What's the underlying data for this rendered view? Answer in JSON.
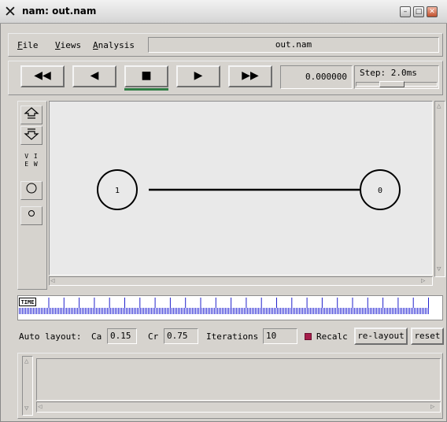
{
  "window": {
    "title": "nam: out.nam",
    "app_icon": "x-logo-icon",
    "controls": [
      "minimize-icon",
      "maximize-icon",
      "close-icon"
    ]
  },
  "menubar": {
    "file_accel": "F",
    "file_rest": "ile",
    "views_accel": "V",
    "views_rest": "iews",
    "analysis_accel": "A",
    "analysis_rest": "nalysis",
    "filename": "out.nam"
  },
  "controls": {
    "rewind": "◀◀",
    "back": "◀",
    "stop": "■",
    "play": "▶",
    "fast_forward": "▶▶",
    "time": "0.000000",
    "step_label": "Step: 2.0ms",
    "active_color": "#2f7d44"
  },
  "toolbar": {
    "view_label_line1": "V I",
    "view_label_line2": "E W",
    "zoom_in_icon": "zoom-in-arrow-icon",
    "zoom_out_icon": "zoom-out-arrow-icon",
    "large_circle_icon": "large-node-icon",
    "small_circle_icon": "small-node-icon"
  },
  "network": {
    "nodes": [
      {
        "id": "1",
        "label": "1"
      },
      {
        "id": "0",
        "label": "0"
      }
    ],
    "links": [
      {
        "from": "1",
        "to": "0"
      }
    ]
  },
  "timeline": {
    "label": "TIME"
  },
  "layout": {
    "auto_label": "Auto layout:",
    "ca_label": "Ca",
    "ca_value": "0.15",
    "cr_label": "Cr",
    "cr_value": "0.75",
    "iterations_label": "Iterations",
    "iterations_value": "10",
    "recalc_label": "Recalc",
    "recalc_checked": true,
    "recalc_color": "#a61d4a",
    "relayout_label": "re-layout",
    "reset_label": "reset"
  }
}
